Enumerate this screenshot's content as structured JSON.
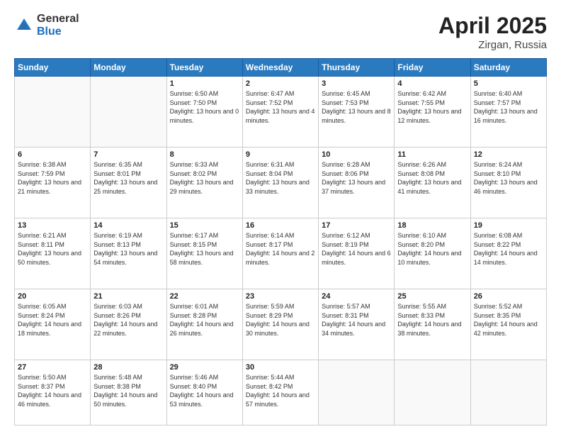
{
  "header": {
    "logo_general": "General",
    "logo_blue": "Blue",
    "title": "April 2025",
    "location": "Zirgan, Russia"
  },
  "weekdays": [
    "Sunday",
    "Monday",
    "Tuesday",
    "Wednesday",
    "Thursday",
    "Friday",
    "Saturday"
  ],
  "days": [
    {
      "num": "",
      "info": ""
    },
    {
      "num": "",
      "info": ""
    },
    {
      "num": "1",
      "info": "Sunrise: 6:50 AM\nSunset: 7:50 PM\nDaylight: 13 hours and 0 minutes."
    },
    {
      "num": "2",
      "info": "Sunrise: 6:47 AM\nSunset: 7:52 PM\nDaylight: 13 hours and 4 minutes."
    },
    {
      "num": "3",
      "info": "Sunrise: 6:45 AM\nSunset: 7:53 PM\nDaylight: 13 hours and 8 minutes."
    },
    {
      "num": "4",
      "info": "Sunrise: 6:42 AM\nSunset: 7:55 PM\nDaylight: 13 hours and 12 minutes."
    },
    {
      "num": "5",
      "info": "Sunrise: 6:40 AM\nSunset: 7:57 PM\nDaylight: 13 hours and 16 minutes."
    },
    {
      "num": "6",
      "info": "Sunrise: 6:38 AM\nSunset: 7:59 PM\nDaylight: 13 hours and 21 minutes."
    },
    {
      "num": "7",
      "info": "Sunrise: 6:35 AM\nSunset: 8:01 PM\nDaylight: 13 hours and 25 minutes."
    },
    {
      "num": "8",
      "info": "Sunrise: 6:33 AM\nSunset: 8:02 PM\nDaylight: 13 hours and 29 minutes."
    },
    {
      "num": "9",
      "info": "Sunrise: 6:31 AM\nSunset: 8:04 PM\nDaylight: 13 hours and 33 minutes."
    },
    {
      "num": "10",
      "info": "Sunrise: 6:28 AM\nSunset: 8:06 PM\nDaylight: 13 hours and 37 minutes."
    },
    {
      "num": "11",
      "info": "Sunrise: 6:26 AM\nSunset: 8:08 PM\nDaylight: 13 hours and 41 minutes."
    },
    {
      "num": "12",
      "info": "Sunrise: 6:24 AM\nSunset: 8:10 PM\nDaylight: 13 hours and 46 minutes."
    },
    {
      "num": "13",
      "info": "Sunrise: 6:21 AM\nSunset: 8:11 PM\nDaylight: 13 hours and 50 minutes."
    },
    {
      "num": "14",
      "info": "Sunrise: 6:19 AM\nSunset: 8:13 PM\nDaylight: 13 hours and 54 minutes."
    },
    {
      "num": "15",
      "info": "Sunrise: 6:17 AM\nSunset: 8:15 PM\nDaylight: 13 hours and 58 minutes."
    },
    {
      "num": "16",
      "info": "Sunrise: 6:14 AM\nSunset: 8:17 PM\nDaylight: 14 hours and 2 minutes."
    },
    {
      "num": "17",
      "info": "Sunrise: 6:12 AM\nSunset: 8:19 PM\nDaylight: 14 hours and 6 minutes."
    },
    {
      "num": "18",
      "info": "Sunrise: 6:10 AM\nSunset: 8:20 PM\nDaylight: 14 hours and 10 minutes."
    },
    {
      "num": "19",
      "info": "Sunrise: 6:08 AM\nSunset: 8:22 PM\nDaylight: 14 hours and 14 minutes."
    },
    {
      "num": "20",
      "info": "Sunrise: 6:05 AM\nSunset: 8:24 PM\nDaylight: 14 hours and 18 minutes."
    },
    {
      "num": "21",
      "info": "Sunrise: 6:03 AM\nSunset: 8:26 PM\nDaylight: 14 hours and 22 minutes."
    },
    {
      "num": "22",
      "info": "Sunrise: 6:01 AM\nSunset: 8:28 PM\nDaylight: 14 hours and 26 minutes."
    },
    {
      "num": "23",
      "info": "Sunrise: 5:59 AM\nSunset: 8:29 PM\nDaylight: 14 hours and 30 minutes."
    },
    {
      "num": "24",
      "info": "Sunrise: 5:57 AM\nSunset: 8:31 PM\nDaylight: 14 hours and 34 minutes."
    },
    {
      "num": "25",
      "info": "Sunrise: 5:55 AM\nSunset: 8:33 PM\nDaylight: 14 hours and 38 minutes."
    },
    {
      "num": "26",
      "info": "Sunrise: 5:52 AM\nSunset: 8:35 PM\nDaylight: 14 hours and 42 minutes."
    },
    {
      "num": "27",
      "info": "Sunrise: 5:50 AM\nSunset: 8:37 PM\nDaylight: 14 hours and 46 minutes."
    },
    {
      "num": "28",
      "info": "Sunrise: 5:48 AM\nSunset: 8:38 PM\nDaylight: 14 hours and 50 minutes."
    },
    {
      "num": "29",
      "info": "Sunrise: 5:46 AM\nSunset: 8:40 PM\nDaylight: 14 hours and 53 minutes."
    },
    {
      "num": "30",
      "info": "Sunrise: 5:44 AM\nSunset: 8:42 PM\nDaylight: 14 hours and 57 minutes."
    },
    {
      "num": "",
      "info": ""
    },
    {
      "num": "",
      "info": ""
    },
    {
      "num": "",
      "info": ""
    }
  ]
}
